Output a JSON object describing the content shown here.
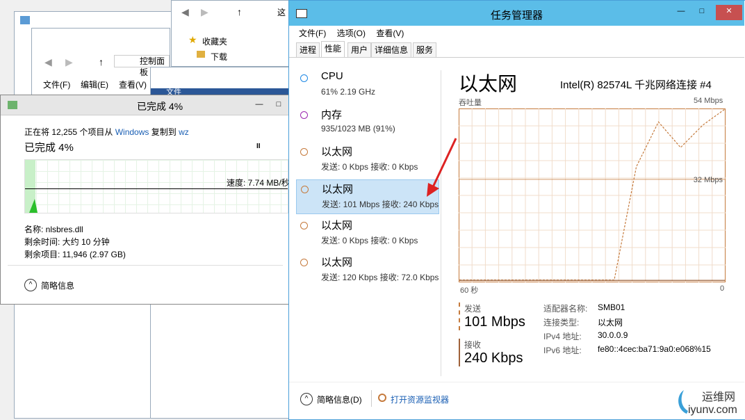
{
  "bg_explorer": {
    "address_partial": "控制面板",
    "menu": [
      "文件(F)",
      "编辑(E)",
      "查看(V)"
    ],
    "ribbon_tab": "文件",
    "top_address": "这",
    "nav_items": [
      {
        "label": "收藏夹",
        "icon": "star-icon"
      },
      {
        "label": "下载",
        "icon": "folder-icon"
      }
    ]
  },
  "copy_dialog": {
    "title": "已完成 4%",
    "status_prefix": "正在将 12,255 个项目从 ",
    "source": "Windows",
    "middle": " 复制到 ",
    "dest": "wz",
    "progress_text": "已完成 4%",
    "pause_glyph": "II",
    "speed": "速度: 7.74 MB/秒",
    "progress": 0.04,
    "name_line": "名称: nlsbres.dll",
    "time_line": "剩余时间: 大约 10 分钟",
    "items_line": "剩余项目: 11,946 (2.97 GB)",
    "summary": "简略信息",
    "btn_min": "—",
    "btn_max": "□"
  },
  "task_manager": {
    "title": "任务管理器",
    "btn_min": "—",
    "btn_max": "□",
    "btn_close": "✕",
    "menu": [
      "文件(F)",
      "选项(O)",
      "查看(V)"
    ],
    "tabs": [
      "进程",
      "性能",
      "用户",
      "详细信息",
      "服务"
    ],
    "active_tab": 1,
    "sidebar": [
      {
        "name": "CPU",
        "sub": "61% 2.19 GHz",
        "color": "#1e88e5"
      },
      {
        "name": "内存",
        "sub": "935/1023 MB (91%)",
        "color": "#9c27b0"
      },
      {
        "name": "以太网",
        "sub": "发送: 0 Kbps 接收: 0 Kbps",
        "color": "#c57a3c"
      },
      {
        "name": "以太网",
        "sub": "发送: 101 Mbps 接收: 240 Kbps",
        "color": "#c57a3c",
        "selected": true
      },
      {
        "name": "以太网",
        "sub": "发送: 0 Kbps 接收: 0 Kbps",
        "color": "#c57a3c"
      },
      {
        "name": "以太网",
        "sub": "发送: 120 Kbps 接收: 72.0 Kbps",
        "color": "#c57a3c"
      }
    ],
    "detail": {
      "heading": "以太网",
      "adapter": "Intel(R) 82574L 千兆网络连接 #4",
      "throughput_label": "吞吐量",
      "max_label": "54 Mbps",
      "mid_label": "32 Mbps",
      "time_left": "60 秒",
      "time_right": "0",
      "send_label": "发送",
      "send_value": "101 Mbps",
      "recv_label": "接收",
      "recv_value": "240 Kbps",
      "props": [
        {
          "k": "适配器名称:",
          "v": "SMB01"
        },
        {
          "k": "连接类型:",
          "v": "以太网"
        },
        {
          "k": "IPv4 地址:",
          "v": "30.0.0.9"
        },
        {
          "k": "IPv6 地址:",
          "v": "fe80::4cec:ba71:9a0:e068%15"
        }
      ]
    },
    "footer_summary": "简略信息(D)",
    "footer_link": "打开资源监视器"
  },
  "watermark": {
    "cn": "运维网",
    "en": "iyunv.com"
  },
  "colors": {
    "accent": "#c57a3c",
    "titlebar": "#5bbde8",
    "link": "#1a5fb4",
    "progress": "#2bbf2b"
  },
  "chart_data": {
    "type": "line",
    "title": "",
    "ylabel": "吞吐量",
    "ylim": [
      0,
      54
    ],
    "x": [
      60,
      55,
      50,
      45,
      40,
      35,
      30,
      25,
      20,
      15,
      10,
      5,
      0
    ],
    "series": [
      {
        "name": "发送",
        "style": "dashed",
        "values": [
          0.5,
          0.5,
          0.5,
          0.5,
          0.5,
          0.5,
          0.5,
          0.5,
          36,
          50,
          42,
          49,
          54
        ]
      },
      {
        "name": "接收",
        "style": "solid",
        "values": [
          0.4,
          0.4,
          0.4,
          0.4,
          0.4,
          0.4,
          0.4,
          0.4,
          0.4,
          0.4,
          0.4,
          0.4,
          0.4
        ]
      }
    ]
  }
}
